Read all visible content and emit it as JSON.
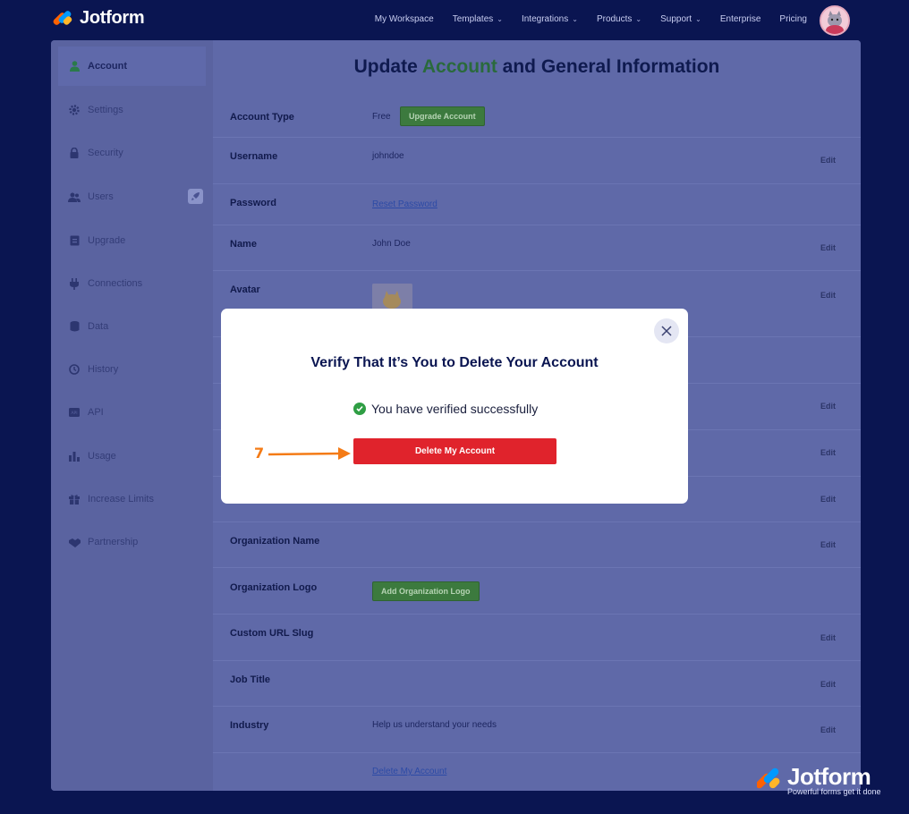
{
  "brand": {
    "name": "Jotform"
  },
  "nav": {
    "items": [
      {
        "label": "My Workspace",
        "dropdown": false
      },
      {
        "label": "Templates",
        "dropdown": true
      },
      {
        "label": "Integrations",
        "dropdown": true
      },
      {
        "label": "Products",
        "dropdown": true
      },
      {
        "label": "Support",
        "dropdown": true
      },
      {
        "label": "Enterprise",
        "dropdown": false
      },
      {
        "label": "Pricing",
        "dropdown": false
      }
    ]
  },
  "sidebar": {
    "items": [
      {
        "label": "Account",
        "icon": "user-icon",
        "active": true
      },
      {
        "label": "Settings",
        "icon": "gear-icon",
        "active": false
      },
      {
        "label": "Security",
        "icon": "lock-icon",
        "active": false
      },
      {
        "label": "Users",
        "icon": "users-icon",
        "active": false
      },
      {
        "label": "Upgrade",
        "icon": "upgrade-icon",
        "active": false
      },
      {
        "label": "Connections",
        "icon": "plug-icon",
        "active": false
      },
      {
        "label": "Data",
        "icon": "database-icon",
        "active": false
      },
      {
        "label": "History",
        "icon": "history-icon",
        "active": false
      },
      {
        "label": "API",
        "icon": "api-icon",
        "active": false
      },
      {
        "label": "Usage",
        "icon": "bar-chart-icon",
        "active": false
      },
      {
        "label": "Increase Limits",
        "icon": "gift-icon",
        "active": false
      },
      {
        "label": "Partnership",
        "icon": "handshake-icon",
        "active": false
      }
    ]
  },
  "page": {
    "title_pre": "Update ",
    "title_highlight": "Account",
    "title_post": " and General Information"
  },
  "rows": {
    "account_type": {
      "label": "Account Type",
      "value": "Free",
      "button": "Upgrade Account"
    },
    "username": {
      "label": "Username",
      "value": "johndoe",
      "edit": "Edit"
    },
    "password": {
      "label": "Password",
      "link": "Reset Password"
    },
    "name": {
      "label": "Name",
      "value": "John Doe",
      "edit": "Edit"
    },
    "avatar": {
      "label": "Avatar",
      "edit": "Edit"
    },
    "row7": {
      "edit": "Edit"
    },
    "row8": {
      "edit": "Edit"
    },
    "row9": {
      "edit": "Edit"
    },
    "org_name": {
      "label": "Organization Name",
      "edit": "Edit"
    },
    "org_logo": {
      "label": "Organization Logo",
      "button": "Add Organization Logo"
    },
    "url_slug": {
      "label": "Custom URL Slug",
      "edit": "Edit"
    },
    "job_title": {
      "label": "Job Title",
      "edit": "Edit"
    },
    "industry": {
      "label": "Industry",
      "value": "Help us understand your needs",
      "edit": "Edit"
    },
    "delete": {
      "link": "Delete My Account"
    }
  },
  "modal": {
    "title": "Verify That It’s You to Delete Your Account",
    "verified_text": "You have verified successfully",
    "delete_button": "Delete My Account"
  },
  "annotation": {
    "step": "7",
    "color": "#f47b16"
  },
  "watermark": {
    "name": "Jotform",
    "tagline": "Powerful forms get it done"
  },
  "colors": {
    "background": "#0a1551",
    "delete_red": "#e0232c",
    "success_green": "#2f9e44",
    "upgrade_green": "#3c7a3e"
  }
}
